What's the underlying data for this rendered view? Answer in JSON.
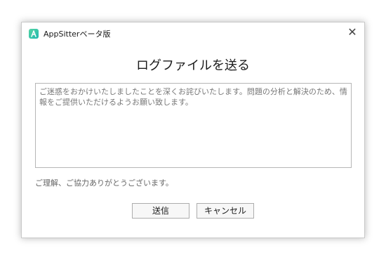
{
  "window": {
    "title": "AppSitterベータ版",
    "icon": "appsitter-logo-icon",
    "close_glyph": "✕"
  },
  "heading": "ログファイルを送る",
  "message": {
    "text": "ご迷惑をおかけいたしましたことを深くお詫びいたします。問題の分析と解決のため、情報をご提供いただけるようお願い致します。"
  },
  "note": "ご理解、ご協力ありがとうございます。",
  "buttons": {
    "send": "送信",
    "cancel": "キャンセル"
  },
  "colors": {
    "icon_gradient_start": "#55d4a3",
    "icon_gradient_end": "#1fb8b0"
  }
}
